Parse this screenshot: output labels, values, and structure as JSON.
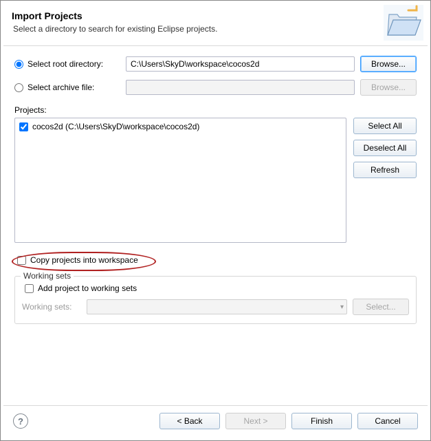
{
  "header": {
    "title": "Import Projects",
    "subtitle": "Select a directory to search for existing Eclipse projects."
  },
  "source": {
    "root_radio_label": "Select root directory:",
    "archive_radio_label": "Select archive file:",
    "root_value": "C:\\Users\\SkyD\\workspace\\cocos2d",
    "archive_value": "",
    "browse_label": "Browse..."
  },
  "projects": {
    "label": "Projects:",
    "items": [
      {
        "checked": true,
        "label": "cocos2d (C:\\Users\\SkyD\\workspace\\cocos2d)"
      }
    ],
    "select_all": "Select All",
    "deselect_all": "Deselect All",
    "refresh": "Refresh"
  },
  "copy_checkbox_label": "Copy projects into workspace",
  "working_sets": {
    "group_title": "Working sets",
    "add_label": "Add project to working sets",
    "combo_label": "Working sets:",
    "select_label": "Select..."
  },
  "footer": {
    "back": "< Back",
    "next": "Next >",
    "finish": "Finish",
    "cancel": "Cancel"
  }
}
